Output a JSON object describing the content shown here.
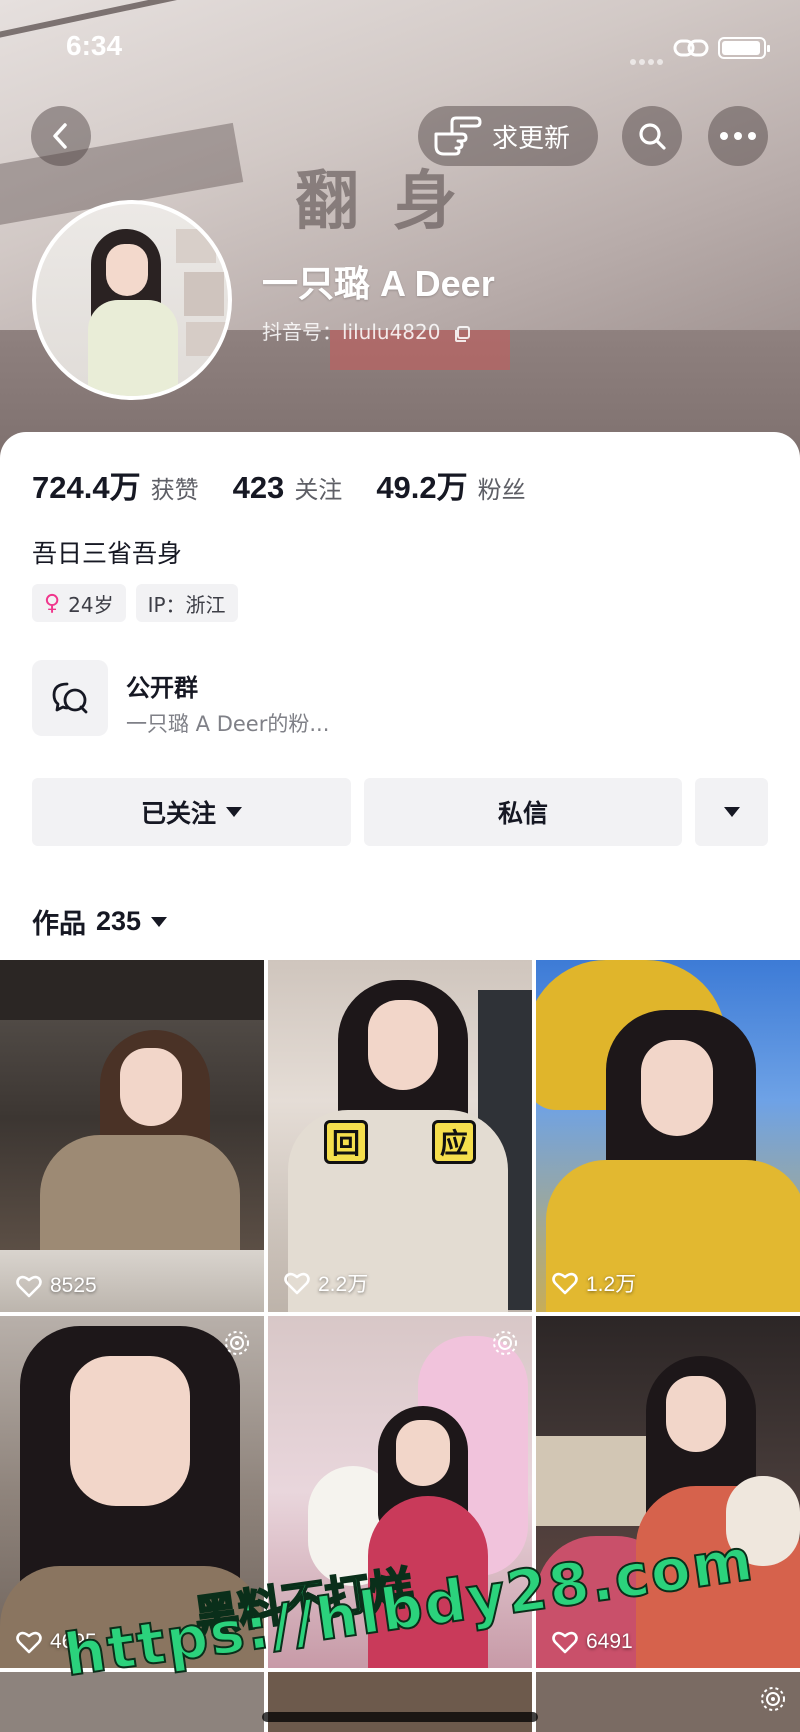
{
  "status_bar": {
    "time": "6:34"
  },
  "header": {
    "update_button_label": "求更新",
    "cover_sign_text": "翻 身",
    "nickname": "一只璐 A Deer",
    "douyin_id": "抖音号：lilulu4820"
  },
  "stats": [
    {
      "value": "724.4万",
      "label": "获赞"
    },
    {
      "value": "423",
      "label": "关注"
    },
    {
      "value": "49.2万",
      "label": "粉丝"
    }
  ],
  "bio": "吾日三省吾身",
  "tags": {
    "age": "24岁",
    "ip": "IP：浙江",
    "gender_symbol": "♀"
  },
  "group": {
    "title": "公开群",
    "desc": "一只璐 A Deer的粉..."
  },
  "actions": {
    "follow_label": "已关注",
    "message_label": "私信"
  },
  "works": {
    "label": "作品",
    "count": "235"
  },
  "videos": [
    {
      "likes": "8525"
    },
    {
      "likes": "2.2万",
      "badge_left": "回",
      "badge_right": "应"
    },
    {
      "likes": "1.2万"
    },
    {
      "likes": "4695"
    },
    {
      "likes": ""
    },
    {
      "likes": "6491"
    }
  ],
  "watermark": {
    "line1": "黑料不打烊",
    "line2": "https://hlbdy28.com"
  },
  "colors": {
    "accent_pink": "#f0368c",
    "watermark_green": "#2bd27c"
  }
}
